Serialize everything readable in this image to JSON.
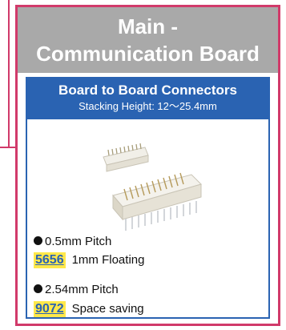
{
  "card": {
    "title_line1": "Main -",
    "title_line2": "Communication Board"
  },
  "panel": {
    "title": "Board to Board Connectors",
    "subtitle": "Stacking Height: 12～25.4mm",
    "image_icon": "board-connector-product-photo"
  },
  "specs": [
    {
      "bullet": "0.5mm Pitch",
      "code": "5656",
      "description": "1mm Floating"
    },
    {
      "bullet": "2.54mm Pitch",
      "code": "9072",
      "description": "Space saving"
    }
  ],
  "colors": {
    "accent_border": "#d13a6a",
    "header_gray": "#a9a9a9",
    "panel_blue": "#2a63b2",
    "code_highlight": "#ffe84a"
  }
}
